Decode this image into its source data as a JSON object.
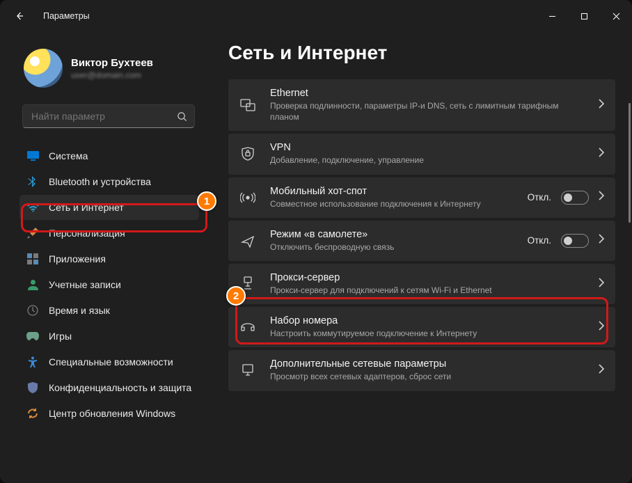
{
  "app_title": "Параметры",
  "profile": {
    "name": "Виктор Бухтеев",
    "email": "user@domain.com"
  },
  "search": {
    "placeholder": "Найти параметр"
  },
  "sidebar": {
    "items": [
      {
        "label": "Система"
      },
      {
        "label": "Bluetooth и устройства"
      },
      {
        "label": "Сеть и Интернет"
      },
      {
        "label": "Персонализация"
      },
      {
        "label": "Приложения"
      },
      {
        "label": "Учетные записи"
      },
      {
        "label": "Время и язык"
      },
      {
        "label": "Игры"
      },
      {
        "label": "Специальные возможности"
      },
      {
        "label": "Конфиденциальность и защита"
      },
      {
        "label": "Центр обновления Windows"
      }
    ],
    "selected_index": 2
  },
  "main": {
    "heading": "Сеть и Интернет",
    "off_label": "Откл.",
    "cards": [
      {
        "title": "Ethernet",
        "sub": "Проверка подлинности, параметры IP-и DNS, сеть с лимитным тарифным планом"
      },
      {
        "title": "VPN",
        "sub": "Добавление, подключение, управление"
      },
      {
        "title": "Мобильный хот-спот",
        "sub": "Совместное использование подключения к Интернету",
        "toggle": true
      },
      {
        "title": "Режим «в самолете»",
        "sub": "Отключить беспроводную связь",
        "toggle": true
      },
      {
        "title": "Прокси-сервер",
        "sub": "Прокси-сервер для подключений к сетям Wi-Fi и Ethernet"
      },
      {
        "title": "Набор номера",
        "sub": "Настроить коммутируемое подключение к Интернету"
      },
      {
        "title": "Дополнительные сетевые параметры",
        "sub": "Просмотр всех сетевых адаптеров, сброс сети"
      }
    ]
  },
  "annotations": {
    "badge1": "1",
    "badge2": "2"
  }
}
